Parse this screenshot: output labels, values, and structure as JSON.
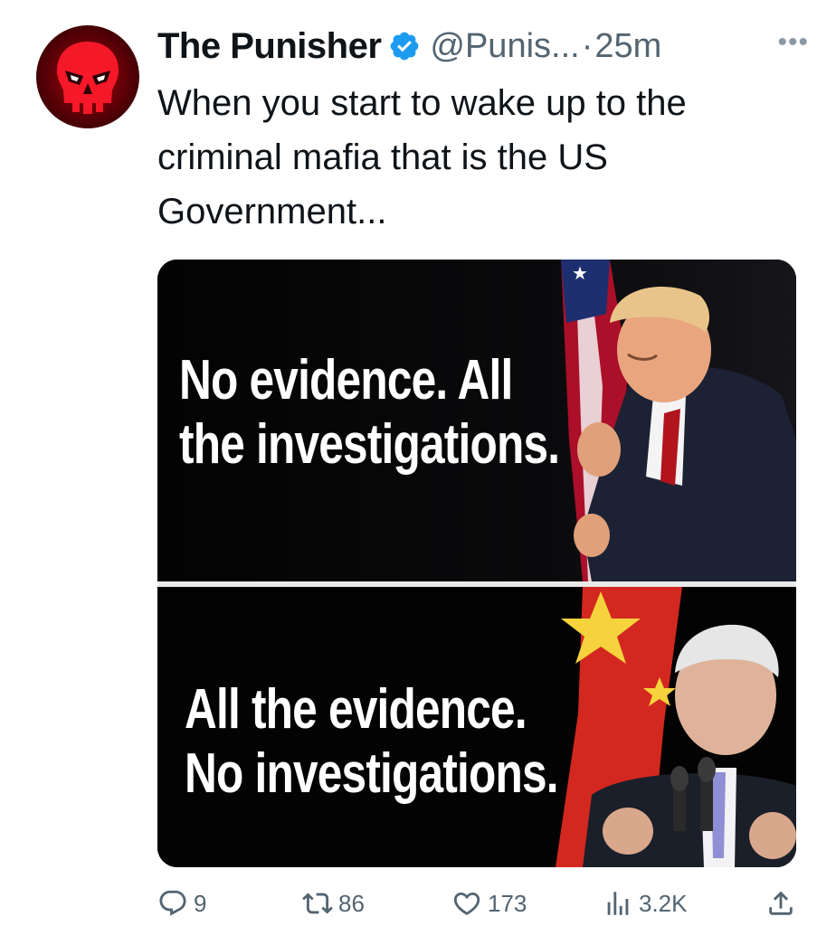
{
  "author": {
    "display_name": "The Punisher",
    "handle": "@Punis...",
    "separator": "·",
    "time": "25m",
    "verified": true,
    "verified_color": "#1d9bf0",
    "avatar_icon": "punisher-skull-icon"
  },
  "tweet": {
    "text": "When you start to wake up to the criminal mafia that is the US Government..."
  },
  "meme": {
    "top_caption_line1": "No evidence. All",
    "top_caption_line2": "the investigations.",
    "bottom_caption_line1": "All the evidence.",
    "bottom_caption_line2": "No investigations."
  },
  "actions": {
    "replies": "9",
    "retweets": "86",
    "likes": "173",
    "views": "3.2K"
  },
  "colors": {
    "text": "#0f1419",
    "secondary": "#536471",
    "accent": "#1d9bf0"
  }
}
